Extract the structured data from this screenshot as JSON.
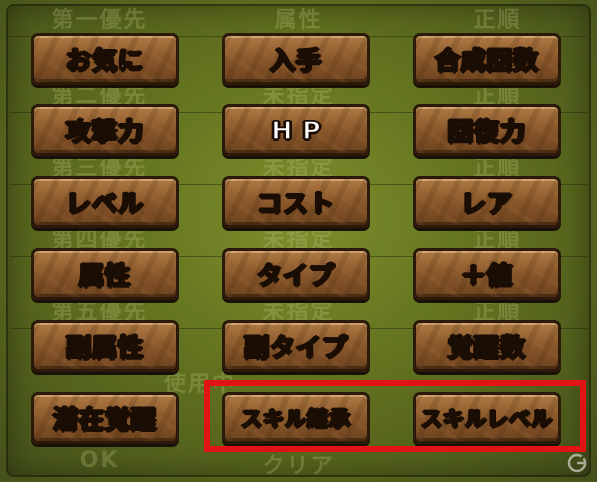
{
  "background": {
    "header_columns": [
      "第一優先",
      "属性",
      "正順"
    ],
    "rows": [
      [
        "第二優先",
        "未指定",
        "正順"
      ],
      [
        "第三優先",
        "未指定",
        "正順"
      ],
      [
        "第四優先",
        "未指定",
        "正順"
      ],
      [
        "第五優先",
        "未指定",
        "正順"
      ]
    ],
    "footer_text": "使用中",
    "ok_label": "OK",
    "clear_label": "クリア"
  },
  "buttons": [
    {
      "id": "favorite",
      "label": "お気に",
      "selected": false
    },
    {
      "id": "obtained",
      "label": "入手",
      "selected": false
    },
    {
      "id": "fusion_count",
      "label": "合成回数",
      "selected": false
    },
    {
      "id": "attack",
      "label": "攻撃力",
      "selected": false
    },
    {
      "id": "hp",
      "label": "HP",
      "selected": false
    },
    {
      "id": "recovery",
      "label": "回復力",
      "selected": false
    },
    {
      "id": "level",
      "label": "レベル",
      "selected": false
    },
    {
      "id": "cost",
      "label": "コスト",
      "selected": false
    },
    {
      "id": "rarity",
      "label": "レア",
      "selected": false
    },
    {
      "id": "attribute",
      "label": "属性",
      "selected": true
    },
    {
      "id": "type",
      "label": "タイプ",
      "selected": false
    },
    {
      "id": "plus_value",
      "label": "＋値",
      "selected": false
    },
    {
      "id": "sub_attribute",
      "label": "副属性",
      "selected": false
    },
    {
      "id": "sub_type",
      "label": "副タイプ",
      "selected": false
    },
    {
      "id": "awakening_count",
      "label": "覚醒数",
      "selected": false
    },
    {
      "id": "latent_awakening",
      "label": "潜在覚醒",
      "selected": false
    },
    {
      "id": "skill_inherit",
      "label": "スキル継承",
      "selected": false
    },
    {
      "id": "skill_level",
      "label": "スキルレベル",
      "selected": false
    }
  ],
  "colors": {
    "selected_label": "#ffe933",
    "normal_label": "#ffffff",
    "highlight_box": "#e01414"
  },
  "watermark_icon": "gamer-logo-icon"
}
